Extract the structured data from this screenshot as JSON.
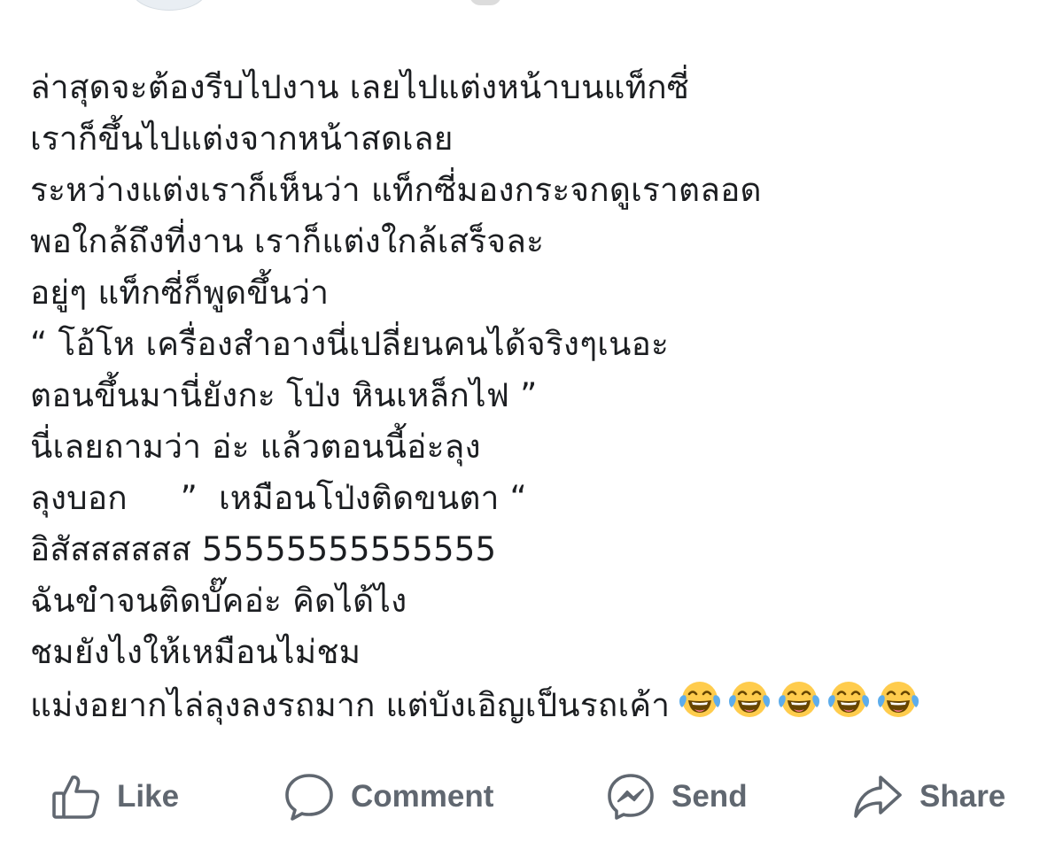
{
  "post": {
    "lines": [
      "ล่าสุดจะต้องรีบไปงาน เลยไปแต่งหน้าบนแท็กซี่",
      "เราก็ขึ้นไปแต่งจากหน้าสดเลย",
      "ระหว่างแต่งเราก็เห็นว่า แท็กซี่มองกระจกดูเราตลอด",
      "พอใกล้ถึงที่งาน เราก็แต่งใกล้เสร็จละ",
      "อยู่ๆ แท็กซี่ก็พูดขึ้นว่า",
      "“ โอ้โห เครื่องสำอางนี่เปลี่ยนคนได้จริงๆเนอะ",
      "ตอนขึ้นมานี่ยังกะ โป่ง หินเหล็กไฟ ”",
      "นี่เลยถามว่า อ่ะ แล้วตอนนี้อ่ะลุง",
      "ลุงบอก     ”  เหมือนโป่งติดขนตา “",
      "อิสัสสสสสส 55555555555555",
      "ฉันขำจนติดบั๊คอ่ะ คิดได้ไง",
      "ชมยังไงให้เหมือนไม่ชม",
      "แม่งอยากไล่ลุงลงรถมาก แต่บังเอิญเป็นรถเค้า"
    ],
    "trailing_emoji": "face-with-tears-of-joy-icon",
    "trailing_emoji_count": 5
  },
  "actions": {
    "like": {
      "label": "Like",
      "icon": "thumbs-up-icon"
    },
    "comment": {
      "label": "Comment",
      "icon": "comment-bubble-icon"
    },
    "send": {
      "label": "Send",
      "icon": "messenger-icon"
    },
    "share": {
      "label": "Share",
      "icon": "share-arrow-icon"
    }
  },
  "colors": {
    "text": "#1c1e21",
    "action": "#606770",
    "emoji_face": "#ffcc4d",
    "emoji_tear": "#5dadec"
  }
}
